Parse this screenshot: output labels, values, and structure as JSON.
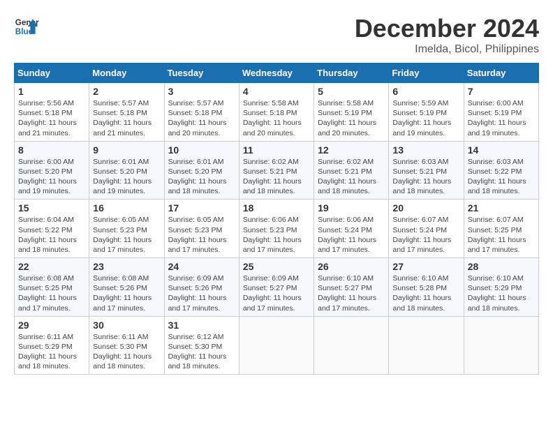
{
  "logo": {
    "line1": "General",
    "line2": "Blue"
  },
  "title": "December 2024",
  "location": "Imelda, Bicol, Philippines",
  "days_of_week": [
    "Sunday",
    "Monday",
    "Tuesday",
    "Wednesday",
    "Thursday",
    "Friday",
    "Saturday"
  ],
  "weeks": [
    [
      {
        "day": "1",
        "info": "Sunrise: 5:56 AM\nSunset: 5:18 PM\nDaylight: 11 hours and 21 minutes."
      },
      {
        "day": "2",
        "info": "Sunrise: 5:57 AM\nSunset: 5:18 PM\nDaylight: 11 hours and 21 minutes."
      },
      {
        "day": "3",
        "info": "Sunrise: 5:57 AM\nSunset: 5:18 PM\nDaylight: 11 hours and 20 minutes."
      },
      {
        "day": "4",
        "info": "Sunrise: 5:58 AM\nSunset: 5:18 PM\nDaylight: 11 hours and 20 minutes."
      },
      {
        "day": "5",
        "info": "Sunrise: 5:58 AM\nSunset: 5:19 PM\nDaylight: 11 hours and 20 minutes."
      },
      {
        "day": "6",
        "info": "Sunrise: 5:59 AM\nSunset: 5:19 PM\nDaylight: 11 hours and 19 minutes."
      },
      {
        "day": "7",
        "info": "Sunrise: 6:00 AM\nSunset: 5:19 PM\nDaylight: 11 hours and 19 minutes."
      }
    ],
    [
      {
        "day": "8",
        "info": "Sunrise: 6:00 AM\nSunset: 5:20 PM\nDaylight: 11 hours and 19 minutes."
      },
      {
        "day": "9",
        "info": "Sunrise: 6:01 AM\nSunset: 5:20 PM\nDaylight: 11 hours and 19 minutes."
      },
      {
        "day": "10",
        "info": "Sunrise: 6:01 AM\nSunset: 5:20 PM\nDaylight: 11 hours and 18 minutes."
      },
      {
        "day": "11",
        "info": "Sunrise: 6:02 AM\nSunset: 5:21 PM\nDaylight: 11 hours and 18 minutes."
      },
      {
        "day": "12",
        "info": "Sunrise: 6:02 AM\nSunset: 5:21 PM\nDaylight: 11 hours and 18 minutes."
      },
      {
        "day": "13",
        "info": "Sunrise: 6:03 AM\nSunset: 5:21 PM\nDaylight: 11 hours and 18 minutes."
      },
      {
        "day": "14",
        "info": "Sunrise: 6:03 AM\nSunset: 5:22 PM\nDaylight: 11 hours and 18 minutes."
      }
    ],
    [
      {
        "day": "15",
        "info": "Sunrise: 6:04 AM\nSunset: 5:22 PM\nDaylight: 11 hours and 18 minutes."
      },
      {
        "day": "16",
        "info": "Sunrise: 6:05 AM\nSunset: 5:23 PM\nDaylight: 11 hours and 17 minutes."
      },
      {
        "day": "17",
        "info": "Sunrise: 6:05 AM\nSunset: 5:23 PM\nDaylight: 11 hours and 17 minutes."
      },
      {
        "day": "18",
        "info": "Sunrise: 6:06 AM\nSunset: 5:23 PM\nDaylight: 11 hours and 17 minutes."
      },
      {
        "day": "19",
        "info": "Sunrise: 6:06 AM\nSunset: 5:24 PM\nDaylight: 11 hours and 17 minutes."
      },
      {
        "day": "20",
        "info": "Sunrise: 6:07 AM\nSunset: 5:24 PM\nDaylight: 11 hours and 17 minutes."
      },
      {
        "day": "21",
        "info": "Sunrise: 6:07 AM\nSunset: 5:25 PM\nDaylight: 11 hours and 17 minutes."
      }
    ],
    [
      {
        "day": "22",
        "info": "Sunrise: 6:08 AM\nSunset: 5:25 PM\nDaylight: 11 hours and 17 minutes."
      },
      {
        "day": "23",
        "info": "Sunrise: 6:08 AM\nSunset: 5:26 PM\nDaylight: 11 hours and 17 minutes."
      },
      {
        "day": "24",
        "info": "Sunrise: 6:09 AM\nSunset: 5:26 PM\nDaylight: 11 hours and 17 minutes."
      },
      {
        "day": "25",
        "info": "Sunrise: 6:09 AM\nSunset: 5:27 PM\nDaylight: 11 hours and 17 minutes."
      },
      {
        "day": "26",
        "info": "Sunrise: 6:10 AM\nSunset: 5:27 PM\nDaylight: 11 hours and 17 minutes."
      },
      {
        "day": "27",
        "info": "Sunrise: 6:10 AM\nSunset: 5:28 PM\nDaylight: 11 hours and 18 minutes."
      },
      {
        "day": "28",
        "info": "Sunrise: 6:10 AM\nSunset: 5:29 PM\nDaylight: 11 hours and 18 minutes."
      }
    ],
    [
      {
        "day": "29",
        "info": "Sunrise: 6:11 AM\nSunset: 5:29 PM\nDaylight: 11 hours and 18 minutes."
      },
      {
        "day": "30",
        "info": "Sunrise: 6:11 AM\nSunset: 5:30 PM\nDaylight: 11 hours and 18 minutes."
      },
      {
        "day": "31",
        "info": "Sunrise: 6:12 AM\nSunset: 5:30 PM\nDaylight: 11 hours and 18 minutes."
      },
      null,
      null,
      null,
      null
    ]
  ]
}
